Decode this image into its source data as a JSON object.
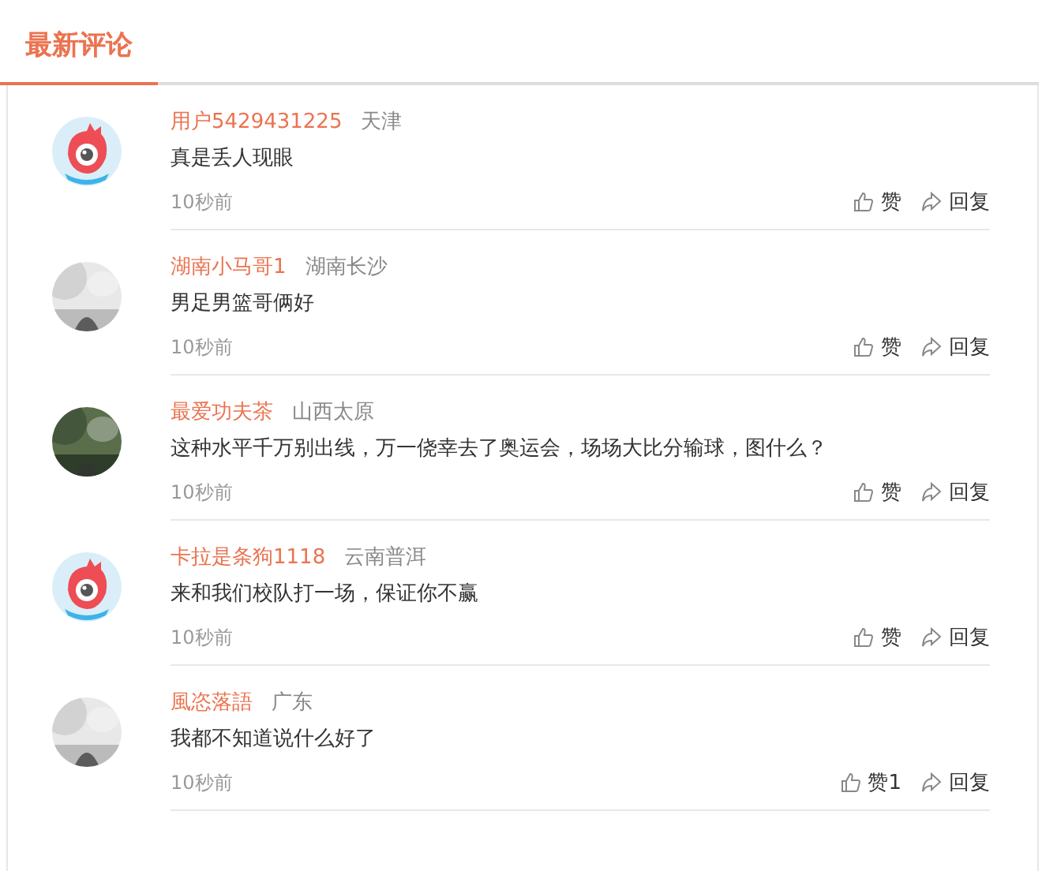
{
  "tab": {
    "label": "最新评论",
    "selected": true
  },
  "comments": [
    {
      "avatar": {
        "kind": "default"
      },
      "user": "用户5429431225",
      "location": "天津",
      "text": "真是丢人现眼",
      "time": "10秒前",
      "like": "赞",
      "reply": "回复"
    },
    {
      "user": "湖南小马哥1",
      "location": "湖南长沙",
      "text": "男足男篮哥俩好",
      "time": "10秒前",
      "like": "赞",
      "reply": "回复"
    },
    {
      "user": "最爱功夫茶",
      "location": "山西太原",
      "text": "这种水平千万别出线，万一侥幸去了奥运会，场场大比分输球，图什么？",
      "time": "10秒前",
      "like": "赞",
      "reply": "回复"
    },
    {
      "avatar": {
        "kind": "default"
      },
      "user": "卡拉是条狗1118",
      "location": "云南普洱",
      "text": "来和我们校队打一场，保证你不赢",
      "time": "10秒前",
      "like": "赞",
      "reply": "回复"
    },
    {
      "user": "風恣落語",
      "location": "广东",
      "text": "我都不知道说什么好了",
      "time": "10秒前",
      "like": "赞1",
      "reply": "回复"
    }
  ]
}
